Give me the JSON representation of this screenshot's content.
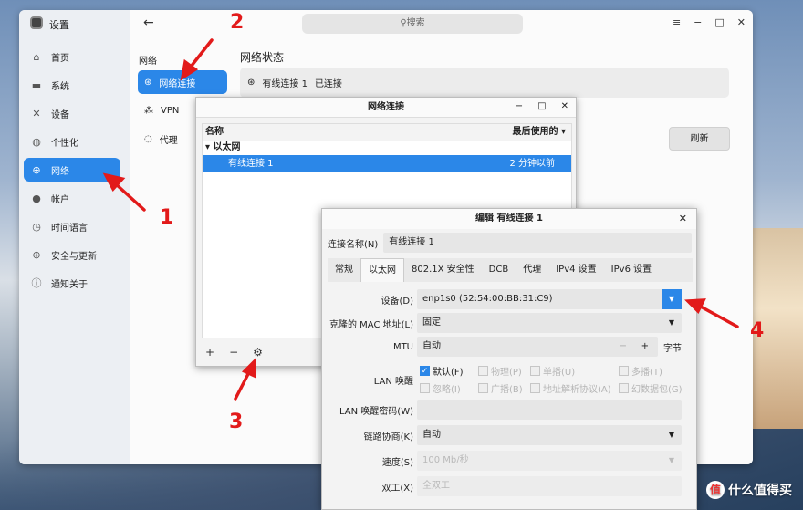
{
  "app": {
    "title": "设置"
  },
  "sidebar": {
    "items": [
      {
        "label": "首页",
        "icon": "home-icon"
      },
      {
        "label": "系统",
        "icon": "display-icon"
      },
      {
        "label": "设备",
        "icon": "tools-icon"
      },
      {
        "label": "个性化",
        "icon": "palette-icon"
      },
      {
        "label": "网络",
        "icon": "globe-icon",
        "active": true
      },
      {
        "label": "帐户",
        "icon": "user-icon"
      },
      {
        "label": "时间语言",
        "icon": "clock-icon"
      },
      {
        "label": "安全与更新",
        "icon": "shield-icon"
      },
      {
        "label": "通知关于",
        "icon": "info-icon"
      }
    ]
  },
  "search": {
    "placeholder": "搜索"
  },
  "network": {
    "section_title": "网络",
    "items": [
      {
        "label": "网络连接"
      },
      {
        "label": "VPN"
      },
      {
        "label": "代理"
      }
    ]
  },
  "status": {
    "title": "网络状态",
    "connection": "有线连接 1",
    "state": "已连接",
    "refresh": "刷新"
  },
  "connections_dialog": {
    "title": "网络连接",
    "col_name": "名称",
    "col_last_used": "最后使用的",
    "group": "以太网",
    "row": {
      "name": "有线连接 1",
      "last_used": "2 分钟以前"
    },
    "add": "+",
    "remove": "−"
  },
  "edit_dialog": {
    "title": "编辑 有线连接 1",
    "name_label": "连接名称(N)",
    "name_value": "有线连接 1",
    "tabs": [
      "常规",
      "以太网",
      "802.1X 安全性",
      "DCB",
      "代理",
      "IPv4 设置",
      "IPv6 设置"
    ],
    "device_label": "设备(D)",
    "device_value": "enp1s0 (52:54:00:BB:31:C9)",
    "mac_label": "克隆的 MAC 地址(L)",
    "mac_value": "固定",
    "mtu_label": "MTU",
    "mtu_value": "自动",
    "mtu_unit": "字节",
    "mtu_minus": "−",
    "mtu_plus": "+",
    "wol_label": "LAN 唤醒",
    "wol_options": [
      "默认(F)",
      "物理(P)",
      "单播(U)",
      "多播(T)",
      "忽略(I)",
      "广播(B)",
      "地址解析协议(A)",
      "幻数据包(G)"
    ],
    "wol_pw_label": "LAN 唤醒密码(W)",
    "wol_pw_value": "",
    "negotiation_label": "链路协商(K)",
    "negotiation_value": "自动",
    "speed_label": "速度(S)",
    "speed_value": "100 Mb/秒",
    "duplex_label": "双工(X)",
    "duplex_value": "全双工"
  },
  "annotations": [
    "1",
    "2",
    "3",
    "4"
  ],
  "watermark": "什么值得买",
  "colors": {
    "accent": "#2b87e8",
    "annotation": "#e21a1a"
  }
}
